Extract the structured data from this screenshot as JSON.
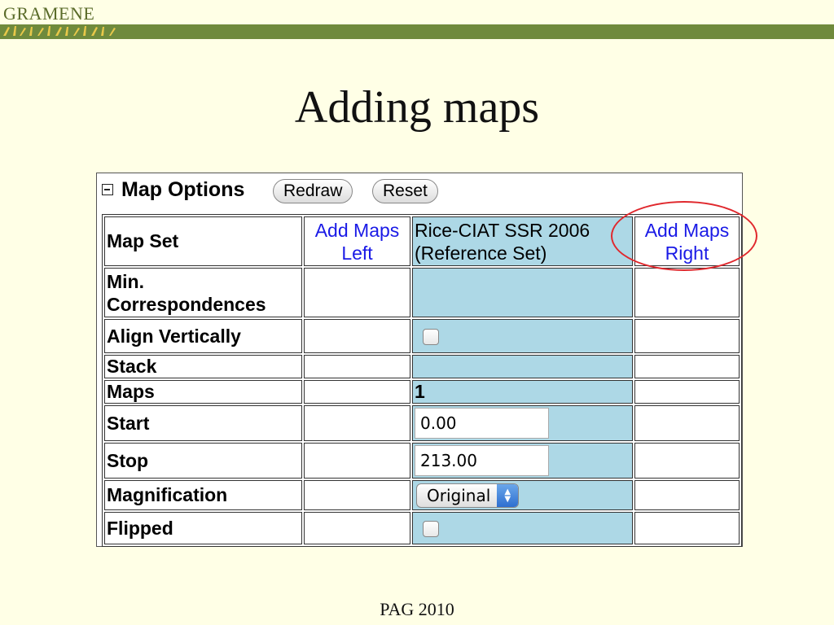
{
  "header": {
    "logo_text": "GRAMENE"
  },
  "slide": {
    "title": "Adding maps",
    "footer": "PAG 2010"
  },
  "panel": {
    "title": "Map Options",
    "redraw_label": "Redraw",
    "reset_label": "Reset"
  },
  "table": {
    "add_left": [
      "Add Maps",
      "Left"
    ],
    "ref_set": [
      "Rice-CIAT SSR 2006",
      "(Reference Set)"
    ],
    "add_right": [
      "Add Maps",
      "Right"
    ],
    "rows": {
      "map_set": "Map Set",
      "min_corr": [
        "Min.",
        "Correspondences"
      ],
      "align": "Align Vertically",
      "stack": "Stack",
      "maps": "Maps",
      "start": "Start",
      "stop": "Stop",
      "magnification": "Magnification",
      "flipped": "Flipped"
    },
    "values": {
      "maps": "1",
      "start": "0.00",
      "stop": "213.00",
      "magnification": "Original"
    }
  },
  "colors": {
    "reference_column": "#add8e6",
    "link": "#1a1ae6",
    "highlight": "#e0282d",
    "band": "#6f8a3c"
  }
}
